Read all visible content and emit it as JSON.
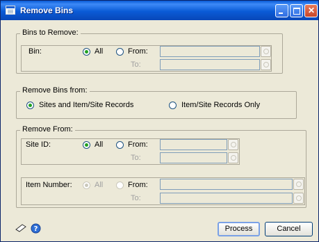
{
  "window": {
    "title": "Remove Bins"
  },
  "bins_to_remove": {
    "group_label": "Bins to Remove:",
    "bin_label": "Bin:",
    "all_label": "All",
    "from_label": "From:",
    "to_label": "To:",
    "from_value": "",
    "to_value": ""
  },
  "remove_bins_from": {
    "group_label": "Remove Bins from:",
    "option_sites": "Sites and Item/Site Records",
    "option_items": "Item/Site Records Only"
  },
  "remove_from": {
    "group_label": "Remove From:",
    "site_id_label": "Site ID:",
    "site_all_label": "All",
    "site_from_label": "From:",
    "site_to_label": "To:",
    "item_number_label": "Item Number:",
    "item_all_label": "All",
    "item_from_label": "From:",
    "item_to_label": "To:"
  },
  "buttons": {
    "process": "Process",
    "cancel": "Cancel"
  },
  "icons": {
    "window": "window-icon",
    "note": "note-icon",
    "help": "help-icon"
  }
}
